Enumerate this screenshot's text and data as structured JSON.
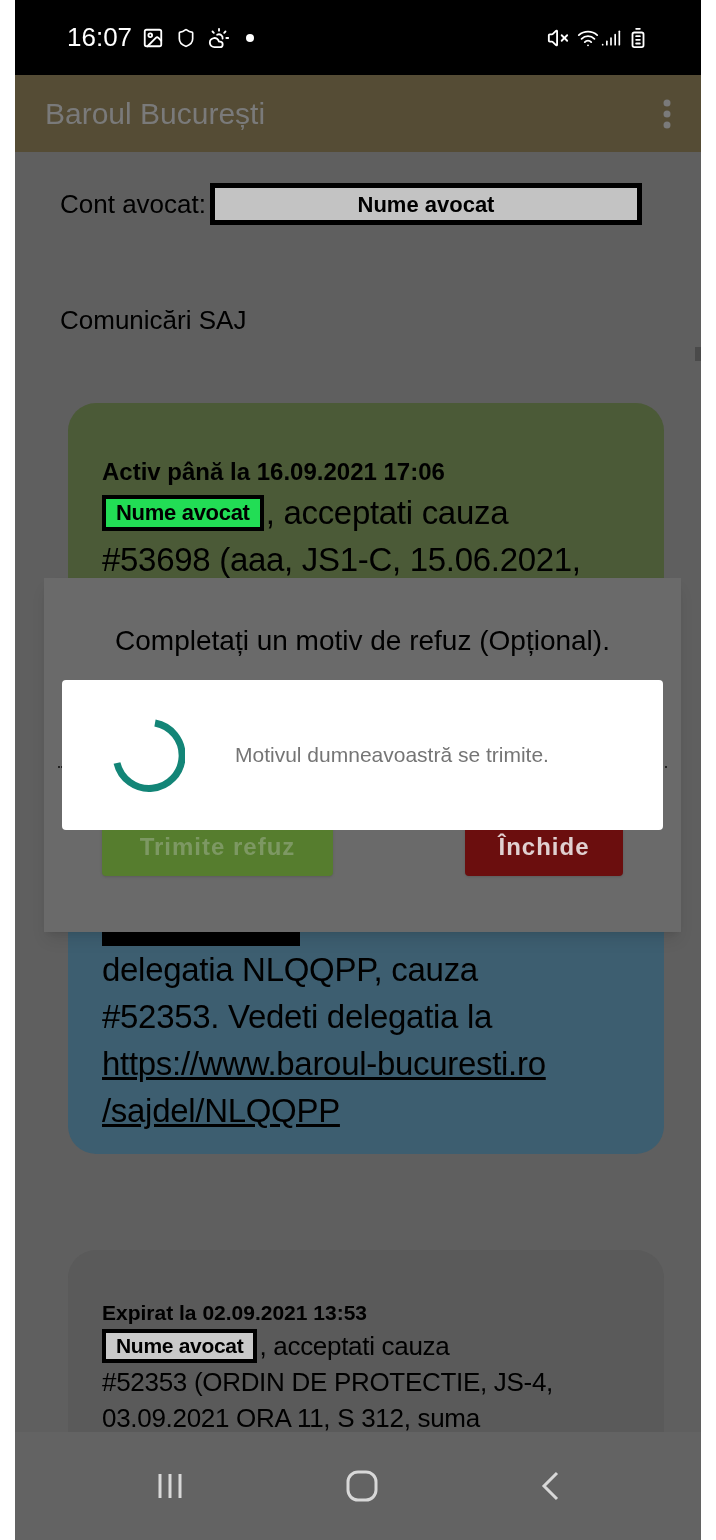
{
  "status_bar": {
    "time": "16:07"
  },
  "app_bar": {
    "title": "Baroul București"
  },
  "account": {
    "label": "Cont avocat:",
    "value": "Nume avocat"
  },
  "section_title": "Comunicări SAJ",
  "messages": [
    {
      "kind": "active",
      "color": "#4b5a37",
      "header": "Activ până la 16.09.2021 17:06",
      "name": "Nume avocat",
      "lines": [
        ", acceptati cauza",
        "#53698 (aaa, JS1-C, 15.06.2021,"
      ]
    },
    {
      "kind": "delegation",
      "color": "#3d5e70",
      "lines": [
        "delegatia NLQQPP, cauza",
        "#52353. Vedeti delegatia la"
      ],
      "link_lines": [
        "https://www.baroul-bucuresti.ro",
        "/sajdel/NLQQPP"
      ]
    },
    {
      "kind": "expired",
      "color": "#5a5a5a",
      "header": "Expirat la 02.09.2021 13:53",
      "name": "Nume avocat",
      "lines": [
        ", acceptati cauza",
        "#52353 (ORDIN DE PROTECTIE, JS-4,",
        "03.09.2021 ORA 11, S 312, suma"
      ]
    }
  ],
  "dialog": {
    "title": "Completați un motiv de refuz (Opțional).",
    "buttons": [
      {
        "label": "Trimite refuz",
        "kind": "send"
      },
      {
        "label": "Închide",
        "kind": "close"
      }
    ]
  },
  "progress": {
    "message": "Motivul dumneavoastră se trimite."
  }
}
